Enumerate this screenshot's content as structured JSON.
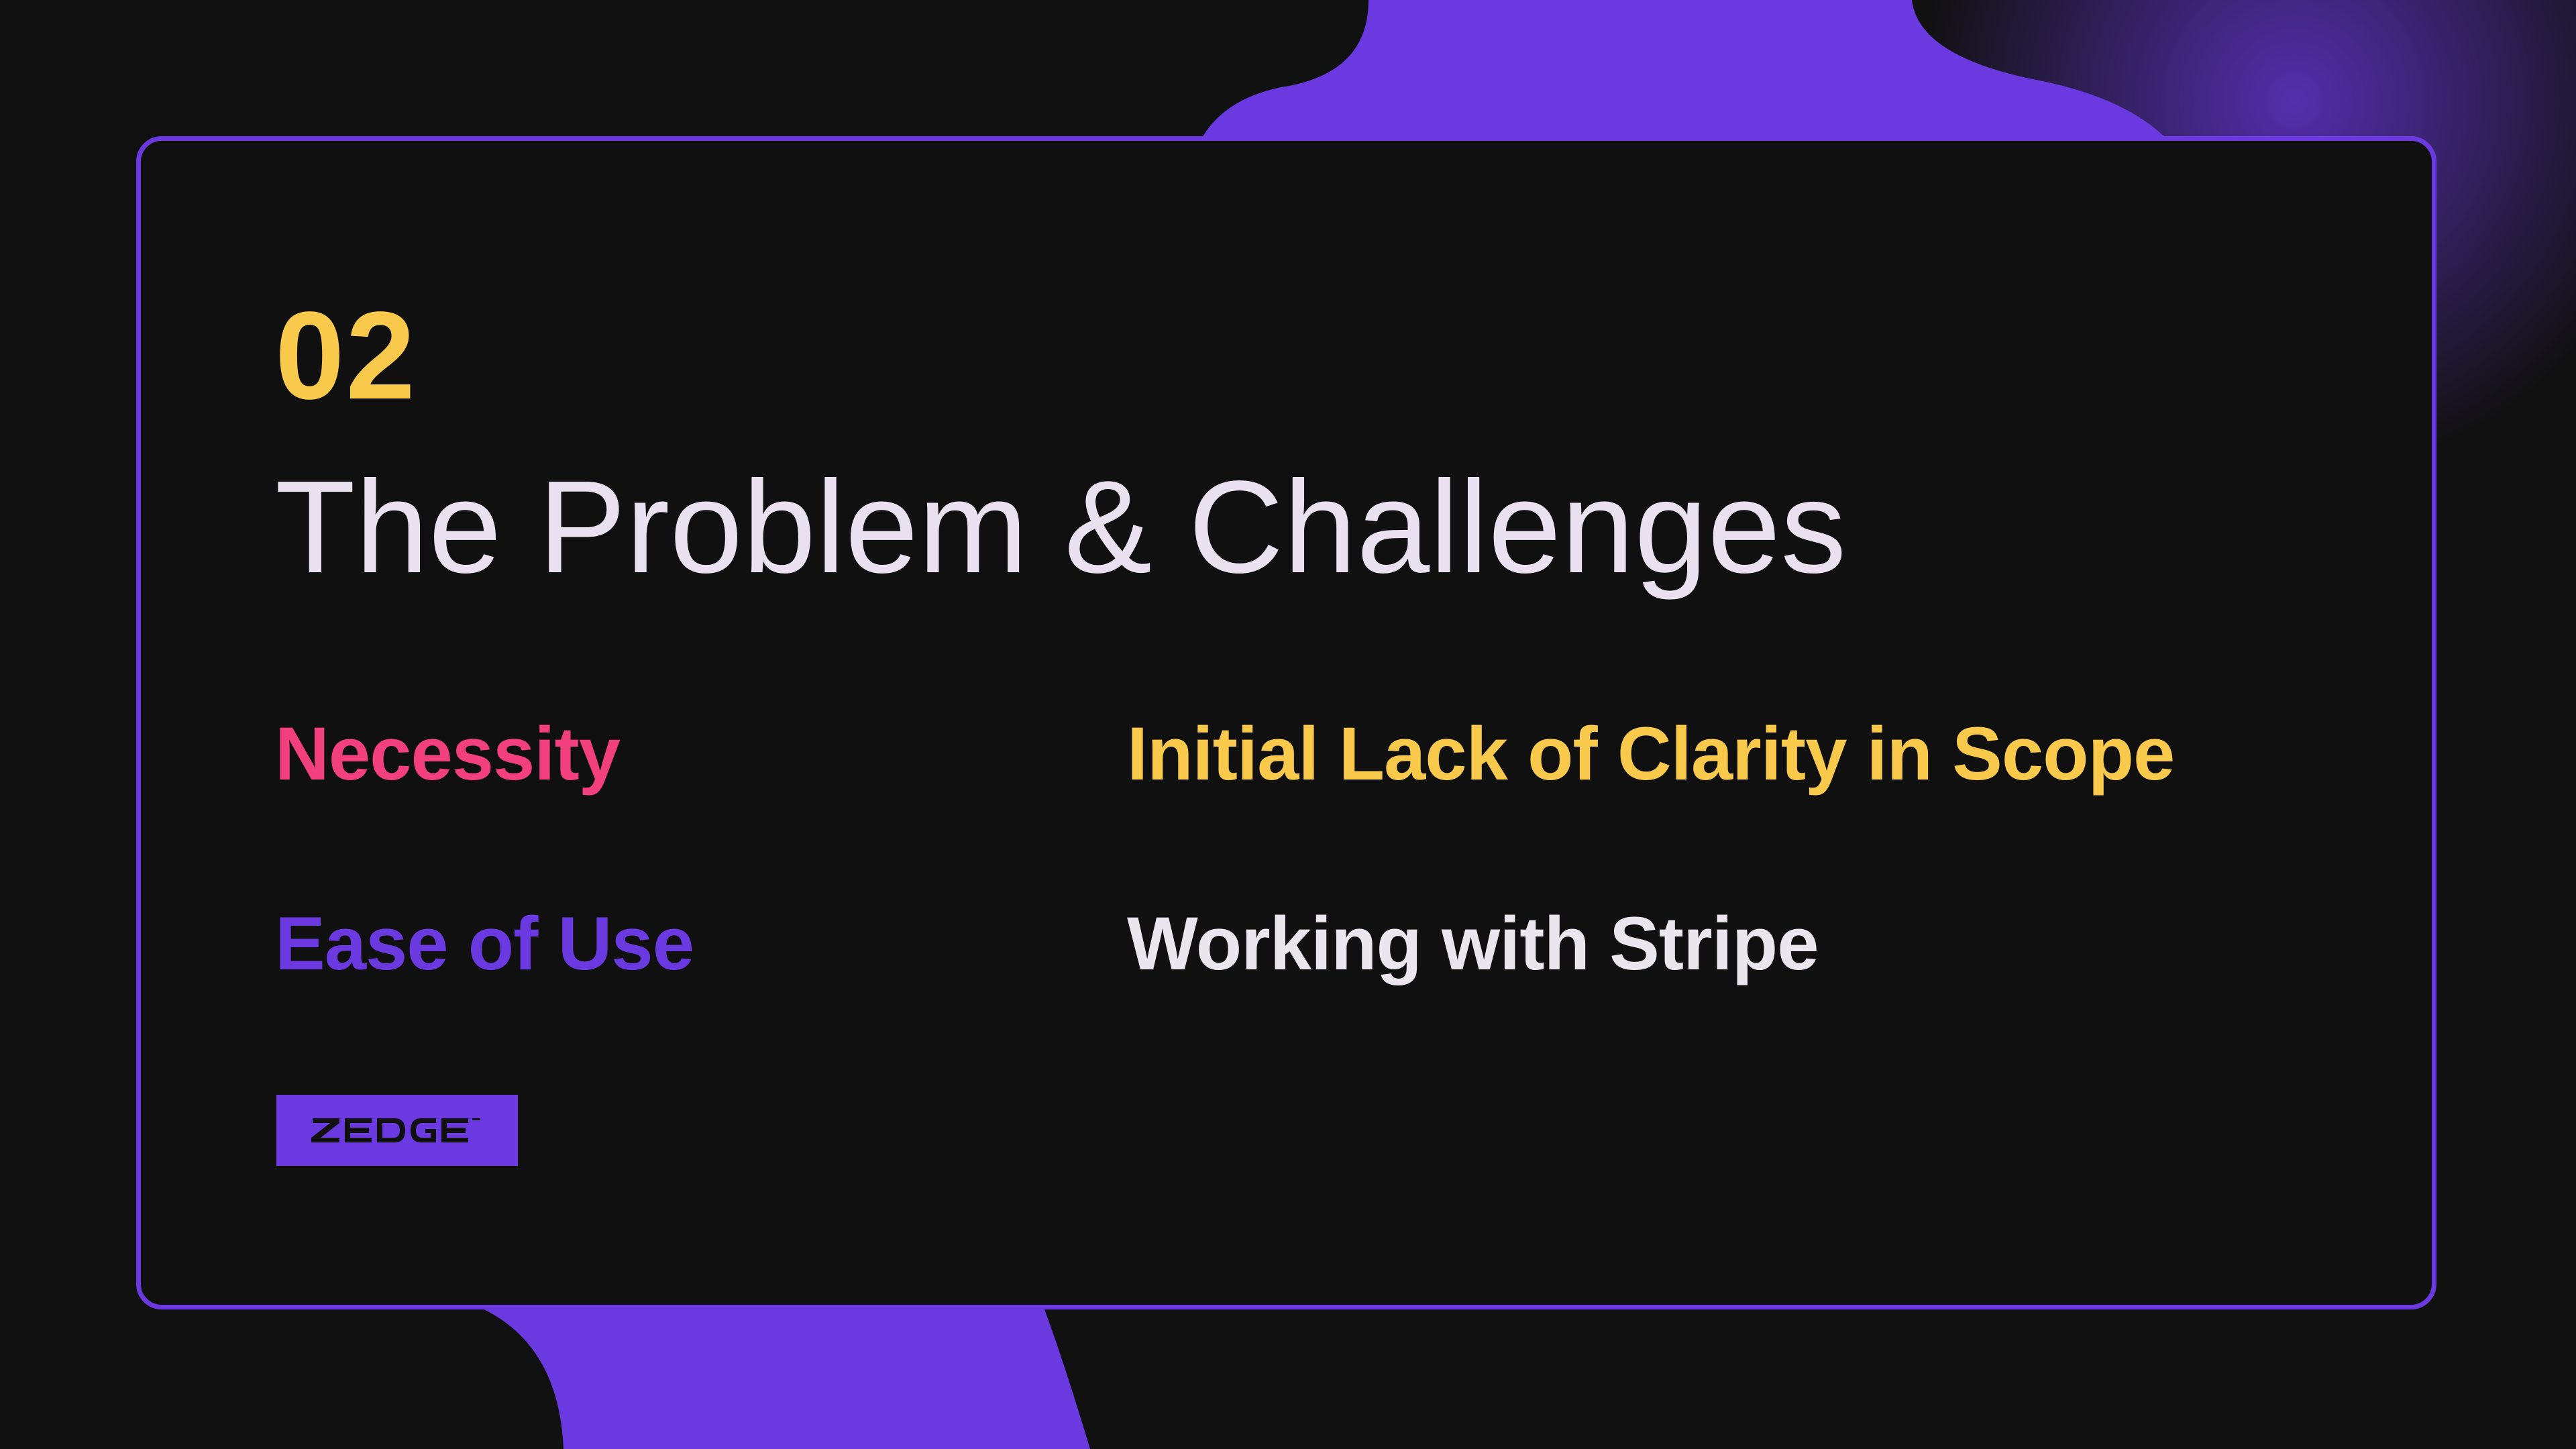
{
  "slide": {
    "number": "02",
    "title": "The Problem & Challenges",
    "points": [
      {
        "text": "Necessity",
        "color": "#f23f7d"
      },
      {
        "text": "Ease of Use",
        "color": "#6a39e0"
      },
      {
        "text": "Initial Lack of Clarity in Scope",
        "color": "#f8c94a"
      },
      {
        "text": "Working with Stripe",
        "color": "#ebe6ee"
      }
    ]
  },
  "logo": {
    "text": "ZEDGE",
    "color": "#6a39e0"
  },
  "theme": {
    "background": "#111111",
    "accent": "#6a39e0",
    "number_color": "#f8c94a",
    "title_color": "#e9e1ef"
  }
}
